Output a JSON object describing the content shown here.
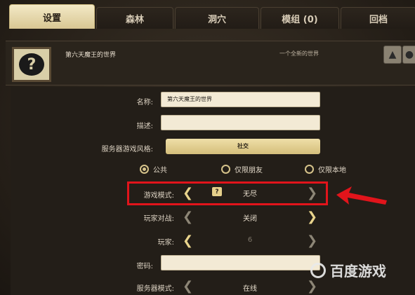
{
  "tabs": [
    {
      "label": "设置",
      "active": true
    },
    {
      "label": "森林",
      "active": false
    },
    {
      "label": "洞穴",
      "active": false
    },
    {
      "label": "模组 (0)",
      "active": false
    },
    {
      "label": "回档",
      "active": false
    }
  ],
  "world": {
    "name": "第六天魔王的世界",
    "subtitle": "一个全新的世界"
  },
  "settings": {
    "name_label": "名称:",
    "name_value": "第六天魔王的世界",
    "desc_label": "描述:",
    "desc_value": "",
    "style_label": "服务器游戏风格:",
    "style_value": "社交",
    "radios": [
      {
        "label": "公共",
        "selected": true
      },
      {
        "label": "仅限朋友",
        "selected": false
      },
      {
        "label": "仅限本地",
        "selected": false
      }
    ],
    "game_mode_label": "游戏模式:",
    "game_mode_value": "无尽",
    "pvp_label": "玩家对战:",
    "pvp_value": "关闭",
    "players_label": "玩家:",
    "players_value": "6",
    "password_label": "密码:",
    "password_value": "",
    "server_mode_label": "服务器模式:",
    "server_mode_value": "在线"
  },
  "annotation": {
    "highlight_color": "#e1141b"
  },
  "watermark": {
    "text": "百度游戏"
  },
  "icons": {
    "avatar": "question-mark-icon",
    "corner1": "character-icon",
    "corner2": "globe-icon",
    "mode": "lock-icon"
  }
}
